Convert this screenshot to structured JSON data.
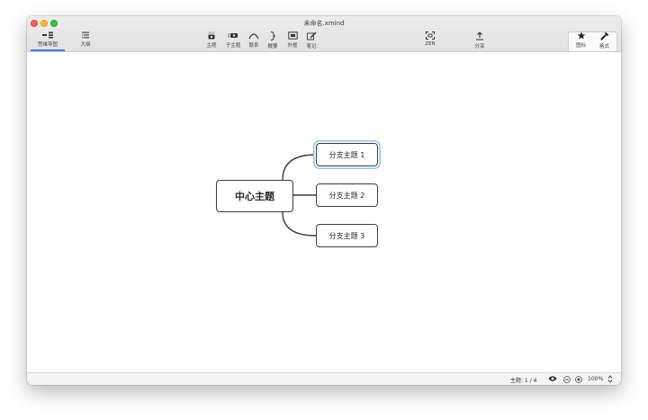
{
  "window": {
    "title": "未命名.xmind"
  },
  "view_tabs": [
    {
      "label": "思维导图",
      "icon": "mindmap-icon",
      "active": true
    },
    {
      "label": "大纲",
      "icon": "outline-icon",
      "active": false
    }
  ],
  "toolbar": {
    "topic": "主题",
    "subtopic": "子主题",
    "relationship": "联系",
    "summary": "概要",
    "boundary": "外框",
    "notes": "笔记",
    "zen": "ZEN",
    "share": "分享",
    "icons": "图标",
    "format": "格式"
  },
  "mindmap": {
    "central": "中心主题",
    "branches": [
      "分支主题 1",
      "分支主题 2",
      "分支主题 3"
    ],
    "selected_branch_index": 0
  },
  "statusbar": {
    "topic_count": "主题: 1 / 4",
    "zoom": "100%"
  },
  "colors": {
    "accent": "#3b7ff3",
    "selection": "#8fc3f5",
    "node_border": "#3d3d3d"
  }
}
